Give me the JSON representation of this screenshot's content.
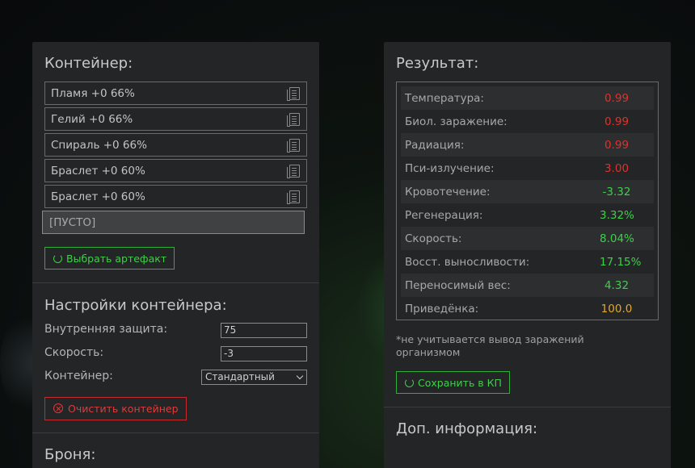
{
  "container": {
    "title": "Контейнер:",
    "slots": [
      {
        "label": "Пламя +0 66%"
      },
      {
        "label": "Гелий +0 66%"
      },
      {
        "label": "Спираль +0 66%"
      },
      {
        "label": "Браслет +0 60%"
      },
      {
        "label": "Браслет +0 60%"
      }
    ],
    "empty_slot": "[ПУСТО]",
    "choose_button": "Выбрать артефакт"
  },
  "settings": {
    "title": "Настройки контейнера:",
    "inner_protection_label": "Внутренняя защита:",
    "inner_protection_value": "75",
    "speed_label": "Скорость:",
    "speed_value": "-3",
    "container_label": "Контейнер:",
    "container_value": "Стандартный",
    "clear_button": "Очистить контейнер"
  },
  "armor": {
    "title": "Броня:"
  },
  "result": {
    "title": "Результат:",
    "rows": [
      {
        "label": "Температура:",
        "value": "0.99",
        "color": "#e0312b"
      },
      {
        "label": "Биол. заражение:",
        "value": "0.99",
        "color": "#e0312b"
      },
      {
        "label": "Радиация:",
        "value": "0.99",
        "color": "#e0312b"
      },
      {
        "label": "Пси-излучение:",
        "value": "3.00",
        "color": "#e0312b"
      },
      {
        "label": "Кровотечение:",
        "value": "-3.32",
        "color": "#3fcf4b"
      },
      {
        "label": "Регенерация:",
        "value": "3.32%",
        "color": "#3fcf4b"
      },
      {
        "label": "Скорость:",
        "value": "8.04%",
        "color": "#3fcf4b"
      },
      {
        "label": "Восст. выносливости:",
        "value": "17.15%",
        "color": "#3fcf4b"
      },
      {
        "label": "Переносимый вес:",
        "value": "4.32",
        "color": "#3fcf4b"
      },
      {
        "label": "Приведёнка:",
        "value": "100.0",
        "color": "#e0a82e"
      }
    ],
    "note": "*не учитывается вывод заражений организмом",
    "save_button": "Сохранить в КП"
  },
  "extra_info": {
    "title": "Доп. информация:"
  }
}
